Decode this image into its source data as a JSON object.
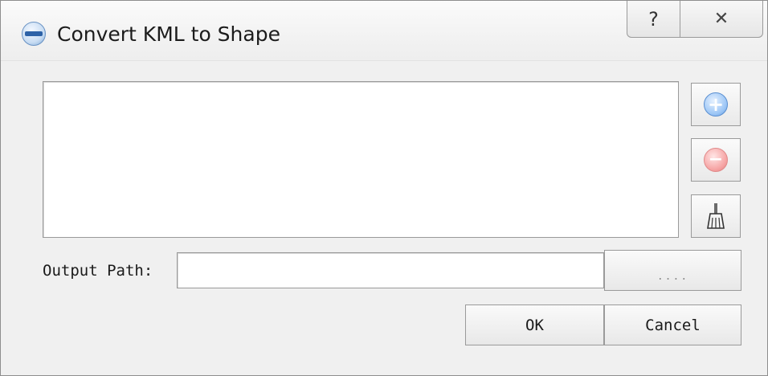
{
  "window": {
    "title": "Convert KML to Shape",
    "app_icon": "globe-app-icon",
    "caption_buttons": {
      "help_glyph": "?",
      "close_glyph": "✕"
    }
  },
  "file_list": {
    "items": []
  },
  "side_buttons": {
    "add_icon": "add-icon",
    "add_glyph": "+",
    "remove_icon": "remove-icon",
    "remove_glyph": "−",
    "clear_icon": "broom-icon"
  },
  "output": {
    "label": "Output Path:",
    "value": "",
    "placeholder": "",
    "browse_label": "...."
  },
  "actions": {
    "ok_label": "OK",
    "cancel_label": "Cancel"
  },
  "colors": {
    "add_accent": "#5f98dd",
    "remove_accent": "#e07b7b",
    "window_bg": "#f0f0f0"
  }
}
